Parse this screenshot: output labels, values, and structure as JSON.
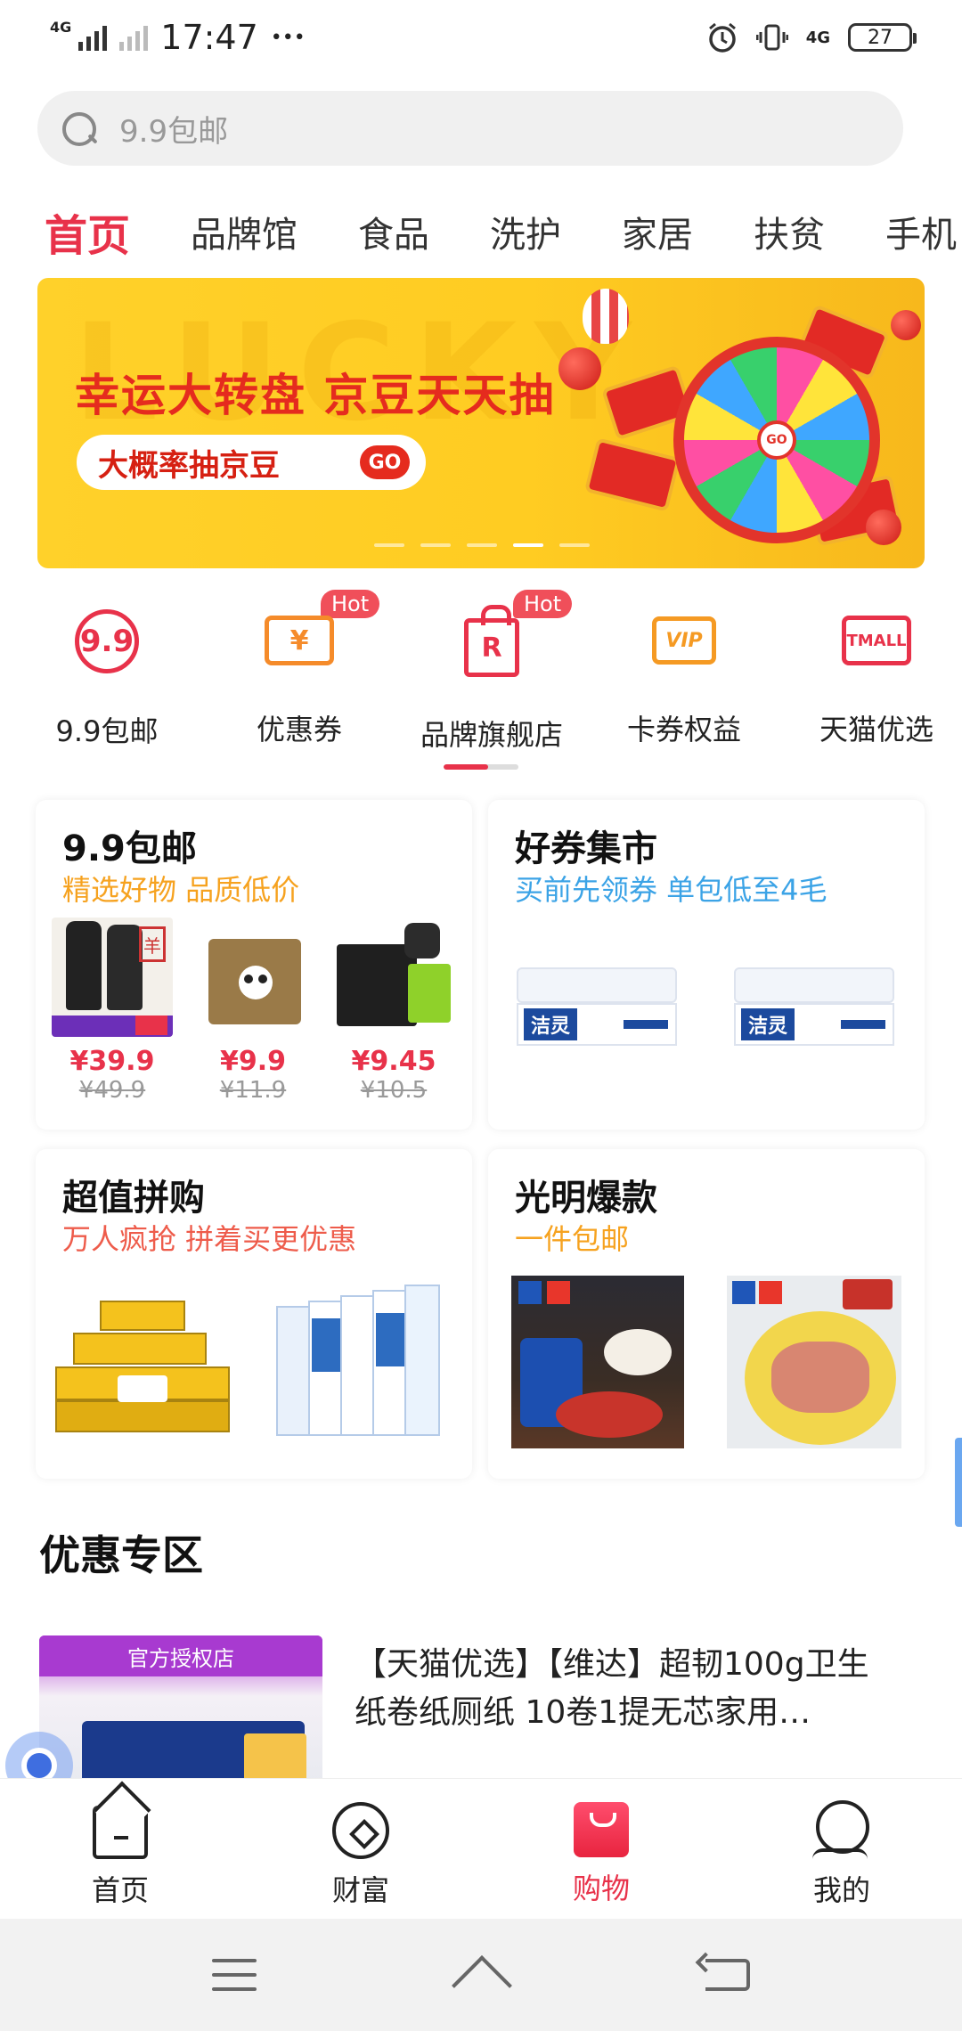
{
  "status_bar": {
    "network": "4G",
    "time": "17:47",
    "more": "•••",
    "alarm_icon": "alarm-icon",
    "vibrate_icon": "vibrate-icon",
    "network_right": "4G",
    "battery": "27"
  },
  "search": {
    "placeholder": "9.9包邮"
  },
  "categories": [
    {
      "label": "首页",
      "active": true
    },
    {
      "label": "品牌馆"
    },
    {
      "label": "食品"
    },
    {
      "label": "洗护"
    },
    {
      "label": "家居"
    },
    {
      "label": "扶贫"
    },
    {
      "label": "手机"
    }
  ],
  "banner": {
    "bg_text": "LUCKY",
    "title": "幸运大转盘 京豆天天抽",
    "pill_text": "大概率抽京豆",
    "go": "GO",
    "wheel_go": "GO",
    "dots": 5,
    "active_dot": 4
  },
  "icon_row": [
    {
      "label": "9.9包邮",
      "glyph": "9.9",
      "hot": ""
    },
    {
      "label": "优惠券",
      "glyph": "¥",
      "hot": "Hot"
    },
    {
      "label": "品牌旗舰店",
      "glyph": "R",
      "hot": "Hot"
    },
    {
      "label": "卡券权益",
      "glyph": "VIP",
      "hot": ""
    },
    {
      "label": "天猫优选",
      "glyph": "TMALL",
      "hot": ""
    }
  ],
  "cards": {
    "baoyou": {
      "title": "9.9包邮",
      "subtitle": "精选好物 品质低价",
      "products": [
        {
          "price": "¥39.9",
          "original": "¥49.9"
        },
        {
          "price": "¥9.9",
          "original": "¥11.9"
        },
        {
          "price": "¥9.45",
          "original": "¥10.5"
        }
      ]
    },
    "coupon_market": {
      "title": "好券集市",
      "subtitle": "买前先领券 单包低至4毛",
      "products": [
        {
          "brand": "洁灵"
        },
        {
          "brand": "洁灵"
        }
      ]
    },
    "group_buy": {
      "title": "超值拼购",
      "subtitle": "万人疯抢 拼着买更优惠"
    },
    "guangming": {
      "title": "光明爆款",
      "subtitle": "一件包邮"
    }
  },
  "deals": {
    "section_title": "优惠专区",
    "item": {
      "image_label": "官方授权店",
      "title": "【天猫优选】【维达】超韧100g卫生纸卷纸厕纸 10卷1提无芯家用…"
    }
  },
  "bottom_nav": [
    {
      "label": "首页",
      "icon": "home-icon"
    },
    {
      "label": "财富",
      "icon": "wealth-icon"
    },
    {
      "label": "购物",
      "icon": "shopping-bag-icon",
      "active": true
    },
    {
      "label": "我的",
      "icon": "profile-icon"
    }
  ],
  "colors": {
    "accent": "#e8324a",
    "orange": "#f6a21f",
    "blue": "#3ba3e6"
  }
}
